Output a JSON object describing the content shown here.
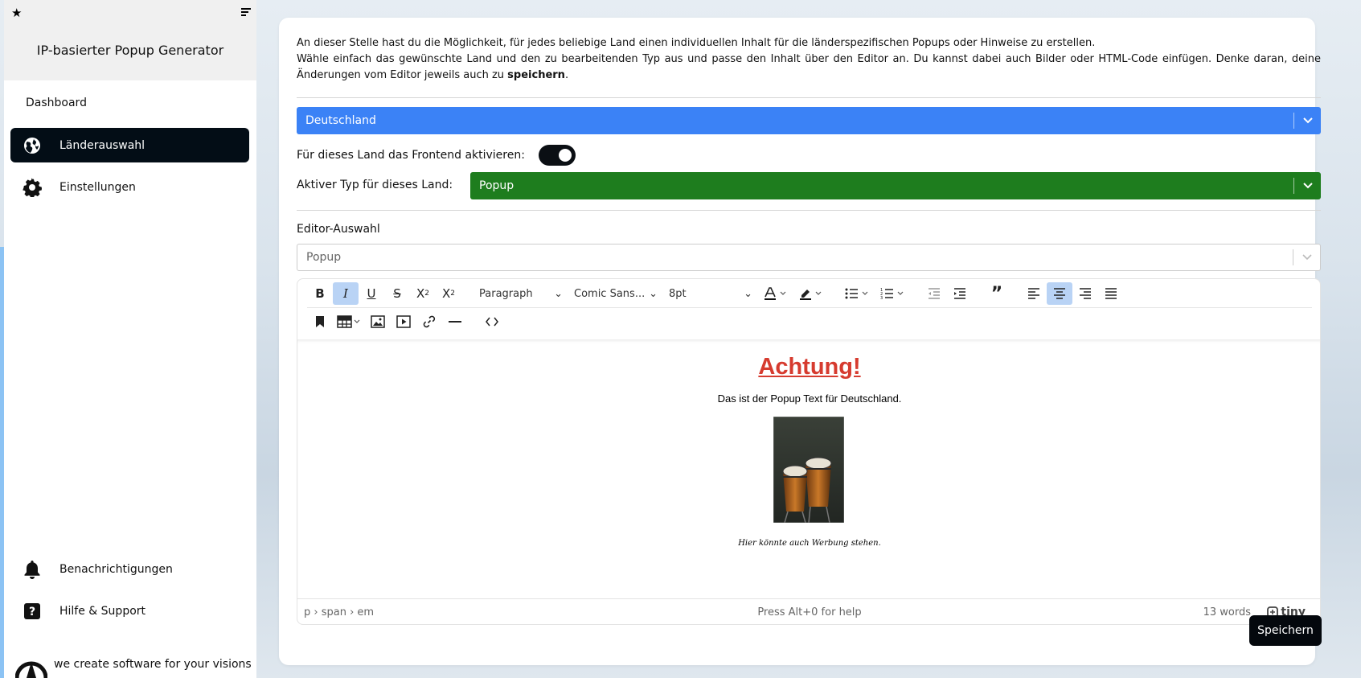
{
  "sidebar": {
    "title": "IP-basierter Popup Generator",
    "nav": {
      "dashboard": "Dashboard",
      "laender": "Länderauswahl",
      "einstellungen": "Einstellungen",
      "benachrichtigungen": "Benachrichtigungen",
      "hilfe": "Hilfe & Support"
    },
    "brand_tagline": "we create software for your visions"
  },
  "main": {
    "intro_line1": "An dieser Stelle hast du die Möglichkeit, für jedes beliebige Land einen individuellen Inhalt für die länderspezifischen Popups oder Hinweise zu erstellen.",
    "intro_line2_a": "Wähle einfach das gewünschte Land und den zu bearbeitenden Typ aus und passe den Inhalt über den Editor an. Du kannst dabei auch Bilder oder HTML-Code einfügen. Denke daran, deine Änderungen vom Editor jeweils auch zu ",
    "intro_line2_bold": "speichern",
    "intro_line2_end": ".",
    "country_select": "Deutschland",
    "frontend_label": "Für dieses Land das Frontend aktivieren:",
    "frontend_active": true,
    "type_label": "Aktiver Typ für dieses Land:",
    "type_select": "Popup",
    "editor_label": "Editor-Auswahl",
    "editor_select": "Popup",
    "save_label": "Speichern"
  },
  "editor": {
    "toolbar": {
      "block_format": "Paragraph",
      "font_family": "Comic Sans...",
      "font_size": "8pt"
    },
    "content": {
      "heading": "Achtung!",
      "paragraph": "Das ist der Popup Text für Deutschland.",
      "caption": "Hier könnte auch Werbung stehen."
    },
    "status": {
      "path": "p › span › em",
      "help": "Press Alt+0 for help",
      "words": "13 words",
      "brand": "tiny"
    }
  },
  "colors": {
    "country_select_bg": "#3b82f6",
    "type_select_bg": "#1e7d1e",
    "active_nav_bg": "#030d16",
    "heading_color": "#d63b2f"
  }
}
